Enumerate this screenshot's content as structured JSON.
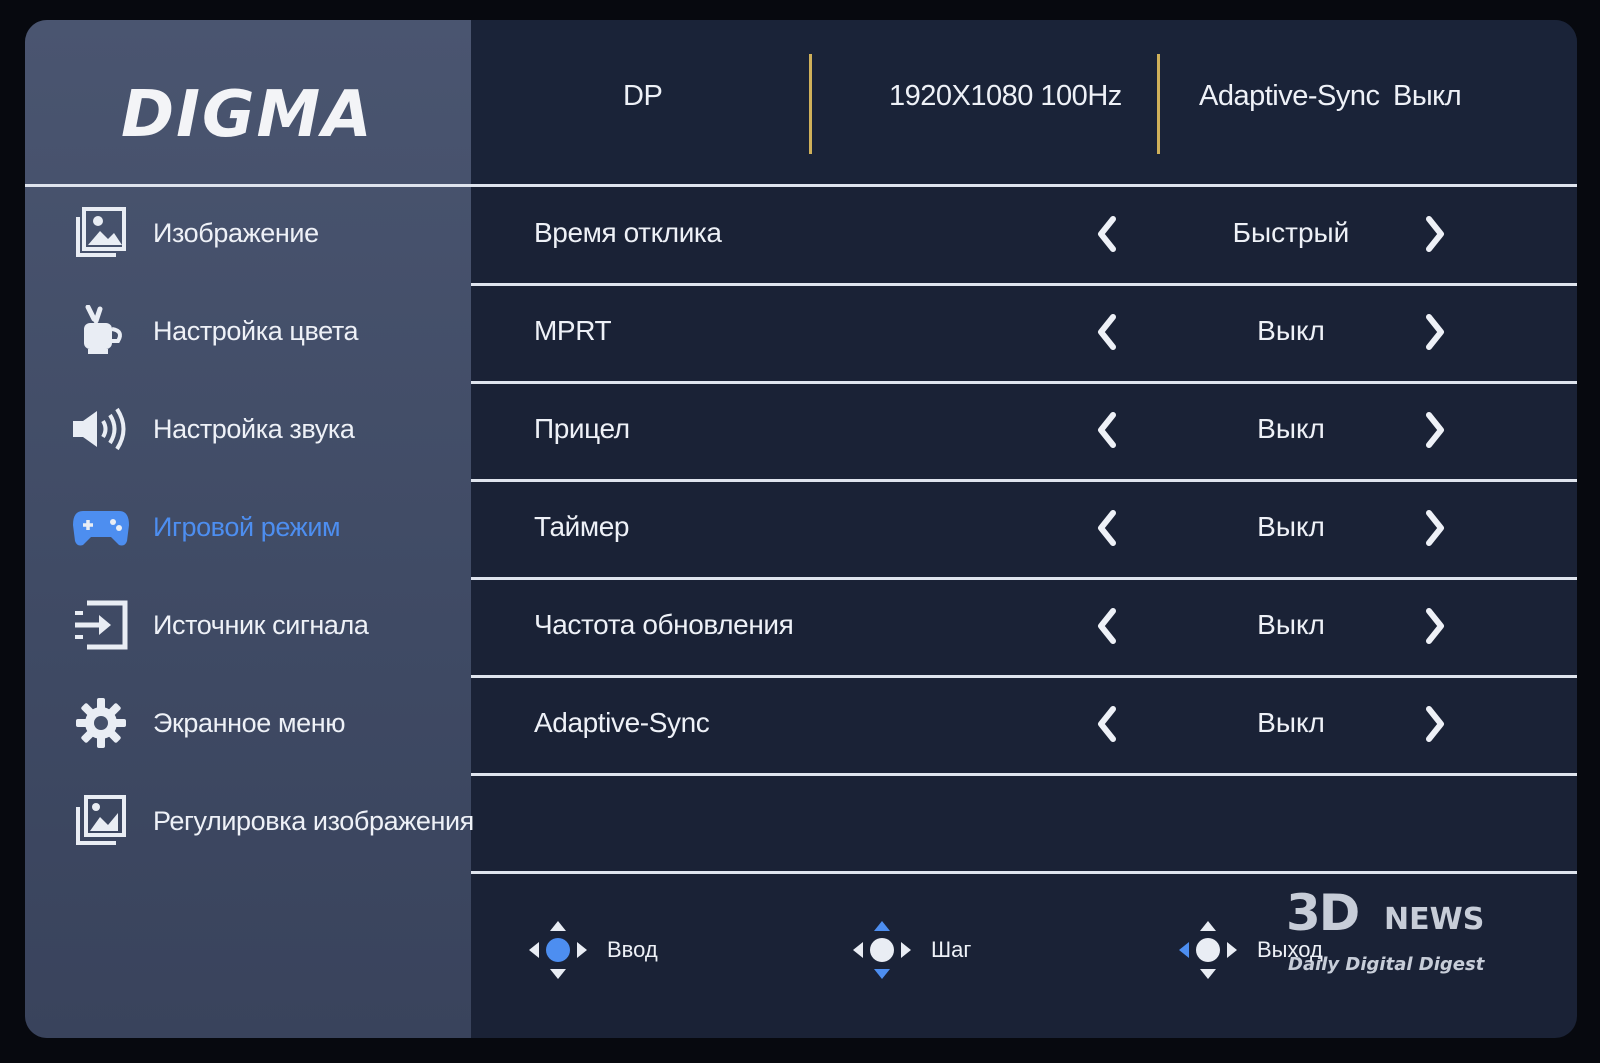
{
  "brand": {
    "logo_text": "DIGMA"
  },
  "status_bar": {
    "input": "DP",
    "resolution": "1920X1080 100Hz",
    "adaptive_sync_label": "Adaptive-Sync",
    "adaptive_sync_value": "Выкл"
  },
  "sidebar": {
    "items": [
      {
        "label": "Изображение",
        "icon": "image-icon",
        "active": false
      },
      {
        "label": "Настройка цвета",
        "icon": "color-palette-icon",
        "active": false
      },
      {
        "label": "Настройка звука",
        "icon": "speaker-icon",
        "active": false
      },
      {
        "label": "Игровой режим",
        "icon": "gamepad-icon",
        "active": true
      },
      {
        "label": "Источник сигнала",
        "icon": "input-source-icon",
        "active": false
      },
      {
        "label": "Экранное меню",
        "icon": "gear-icon",
        "active": false
      },
      {
        "label": "Регулировка изображения",
        "icon": "image-adjust-icon",
        "active": false
      }
    ]
  },
  "settings": {
    "rows": [
      {
        "label": "Время отклика",
        "value": "Быстрый"
      },
      {
        "label": "MPRT",
        "value": "Выкл"
      },
      {
        "label": "Прицел",
        "value": "Выкл"
      },
      {
        "label": "Таймер",
        "value": "Выкл"
      },
      {
        "label": "Частота обновления",
        "value": "Выкл"
      },
      {
        "label": "Adaptive-Sync",
        "value": "Выкл"
      }
    ]
  },
  "legend": {
    "enter": "Ввод",
    "step": "Шаг",
    "exit": "Выход"
  },
  "watermark": {
    "logo": "3D",
    "news": "NEWS",
    "tagline": "Daily Digital Digest"
  },
  "colors": {
    "accent_active": "#4d8ef0",
    "separator_gold": "#cfb05a",
    "panel_bg": "#1a2236",
    "sidebar_bg": "#434e68"
  }
}
